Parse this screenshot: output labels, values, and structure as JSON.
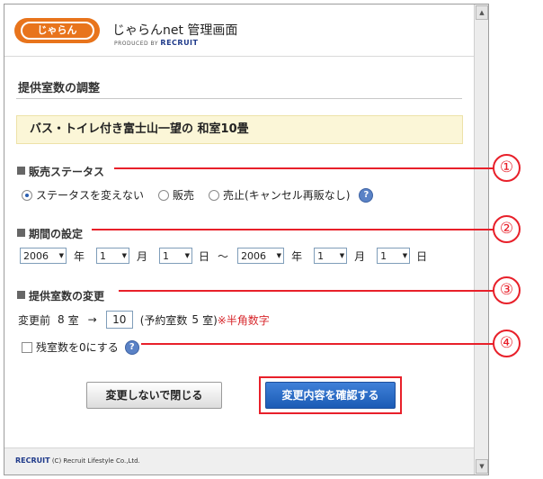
{
  "header": {
    "logo_text": "じゃらん",
    "brand_title": "じゃらんnet 管理画面",
    "produced_by": "PRODUCED BY",
    "recruit": "RECRUIT"
  },
  "page": {
    "title": "提供室数の調整",
    "room_name": "バス・トイレ付き富士山一望の 和室10畳"
  },
  "sales_status": {
    "title": "販売ステータス",
    "options": [
      {
        "label": "ステータスを変えない",
        "selected": true
      },
      {
        "label": "販売",
        "selected": false
      },
      {
        "label": "売止(キャンセル再販なし)",
        "selected": false
      }
    ]
  },
  "period": {
    "title": "期間の設定",
    "from": {
      "year": "2006",
      "month": "1",
      "day": "1"
    },
    "to": {
      "year": "2006",
      "month": "1",
      "day": "1"
    },
    "year_unit": "年",
    "month_unit": "月",
    "day_unit": "日",
    "tilde": "～"
  },
  "room_count": {
    "title": "提供室数の変更",
    "before_label": "変更前",
    "before_value": "8",
    "room_unit": "室",
    "arrow": "→",
    "new_value": "10",
    "reserved_open": "(予約室数",
    "reserved_value": "5",
    "reserved_close": "室)",
    "note": "※半角数字"
  },
  "zero_rooms": {
    "label": "残室数を0にする",
    "checked": false
  },
  "help_symbol": "?",
  "buttons": {
    "close_label": "変更しないで閉じる",
    "confirm_label": "変更内容を確認する"
  },
  "footer": {
    "recruit": "RECRUIT",
    "copyright": "(C) Recruit Lifestyle Co.,Ltd."
  },
  "annotations": [
    "①",
    "②",
    "③",
    "④"
  ],
  "colors": {
    "annotation_red": "#e8202a",
    "confirm_button_blue": "#2a6cc8",
    "room_box_bg": "#fbf6d7",
    "note_red": "#d7262b",
    "logo_orange": "#e8741c"
  }
}
